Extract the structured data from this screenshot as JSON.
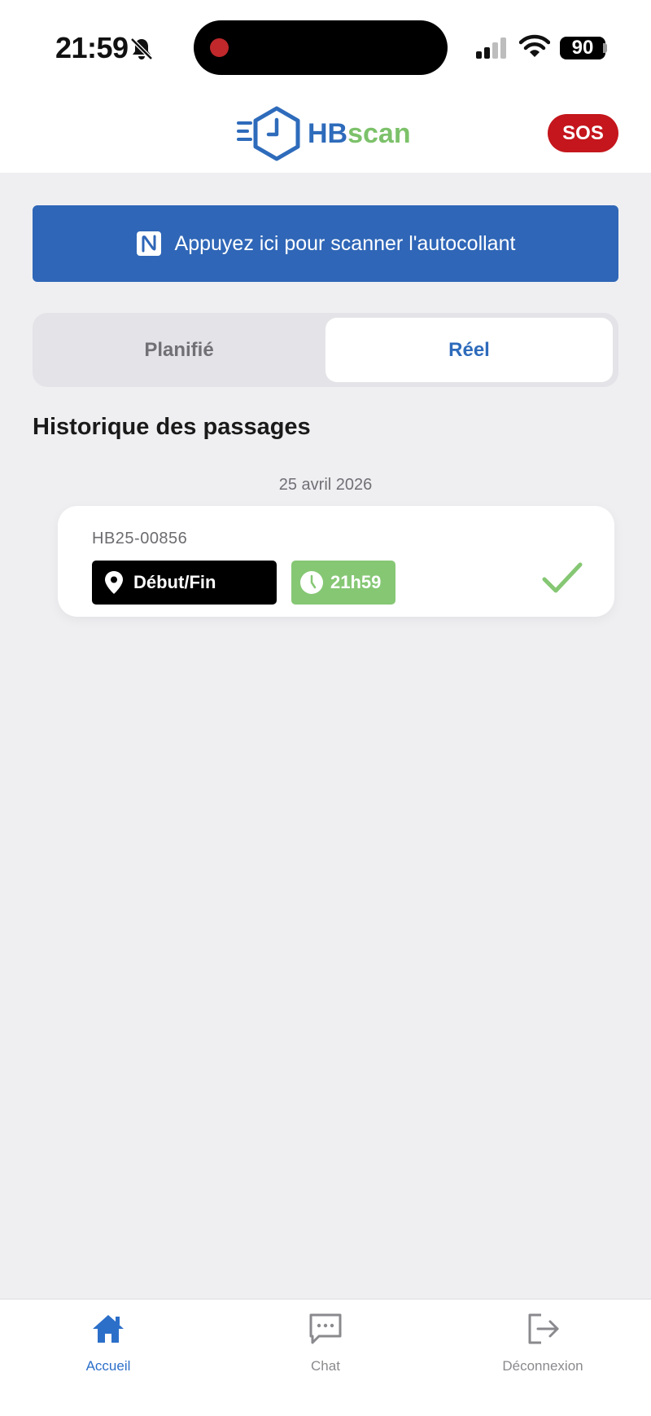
{
  "status_bar": {
    "time": "21:59",
    "battery": "90"
  },
  "header": {
    "logo_hb": "HB",
    "logo_scan": "scan",
    "sos_label": "SOS"
  },
  "scan": {
    "label": "Appuyez ici pour scanner l'autocollant"
  },
  "segments": {
    "planned": "Planifié",
    "actual": "Réel",
    "active": "Réel"
  },
  "history": {
    "title": "Historique des passages",
    "groups": [
      {
        "date": "25 avril 2026",
        "entries": [
          {
            "id": "HB25-00856",
            "location": "Début/Fin",
            "time": "21h59",
            "status": "done"
          }
        ]
      }
    ]
  },
  "nav": {
    "home": "Accueil",
    "chat": "Chat",
    "logout": "Déconnexion",
    "active": "Accueil"
  },
  "colors": {
    "brand_blue": "#2f66b7",
    "brand_green": "#86c774",
    "sos_red": "#c4161c",
    "nav_active": "#2c6fc9"
  }
}
